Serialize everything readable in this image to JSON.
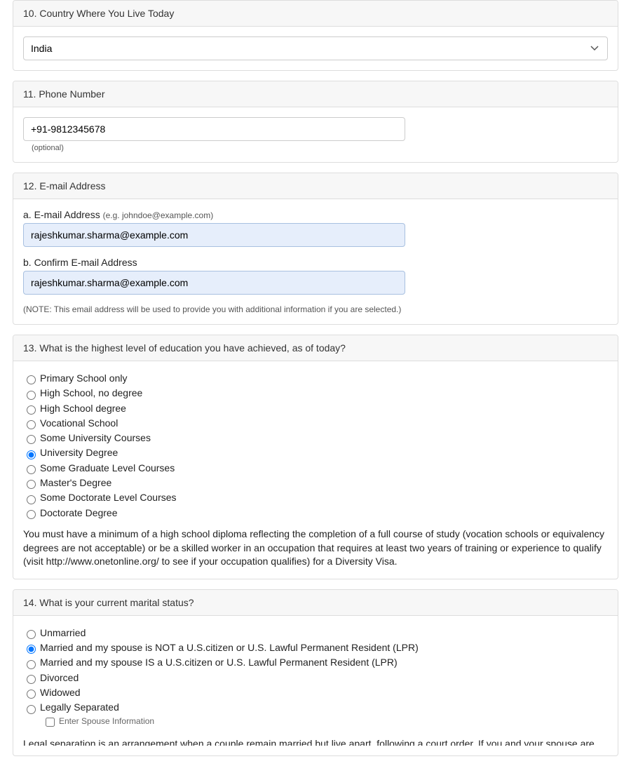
{
  "q10": {
    "title": "10. Country Where You Live Today",
    "value": "India"
  },
  "q11": {
    "title": "11. Phone Number",
    "value": "+91-9812345678",
    "optional": "(optional)"
  },
  "q12": {
    "title": "12. E-mail Address",
    "a_label": "a. E-mail Address ",
    "a_hint": "(e.g. johndoe@example.com)",
    "a_value": "rajeshkumar.sharma@example.com",
    "b_label": "b. Confirm E-mail Address",
    "b_value": "rajeshkumar.sharma@example.com",
    "note": "(NOTE: This email address will be used to provide you with additional information if you are selected.)"
  },
  "q13": {
    "title": "13. What is the highest level of education you have achieved, as of today?",
    "options": [
      "Primary School only",
      "High School, no degree",
      "High School degree",
      "Vocational School",
      "Some University Courses",
      "University Degree",
      "Some Graduate Level Courses",
      "Master's Degree",
      "Some Doctorate Level Courses",
      "Doctorate Degree"
    ],
    "selected_index": 5,
    "info": "You must have a minimum of a high school diploma reflecting the completion of a full course of study (vocation schools or equivalency degrees are not acceptable) or be a skilled worker in an occupation that requires at least two years of training or experience to qualify (visit http://www.onetonline.org/ to see if your occupation qualifies) for a Diversity Visa."
  },
  "q14": {
    "title": "14. What is your current marital status?",
    "options": [
      "Unmarried",
      "Married and my spouse is NOT a U.S.citizen or U.S. Lawful Permanent Resident (LPR)",
      "Married and my spouse IS a U.S.citizen or U.S. Lawful Permanent Resident (LPR)",
      "Divorced",
      "Widowed",
      "Legally Separated"
    ],
    "selected_index": 1,
    "spouse_checkbox_label": "Enter Spouse Information",
    "cutoff": "Legal separation is an arrangement when a couple remain married but live apart, following a court order. If you and your spouse are legally"
  }
}
